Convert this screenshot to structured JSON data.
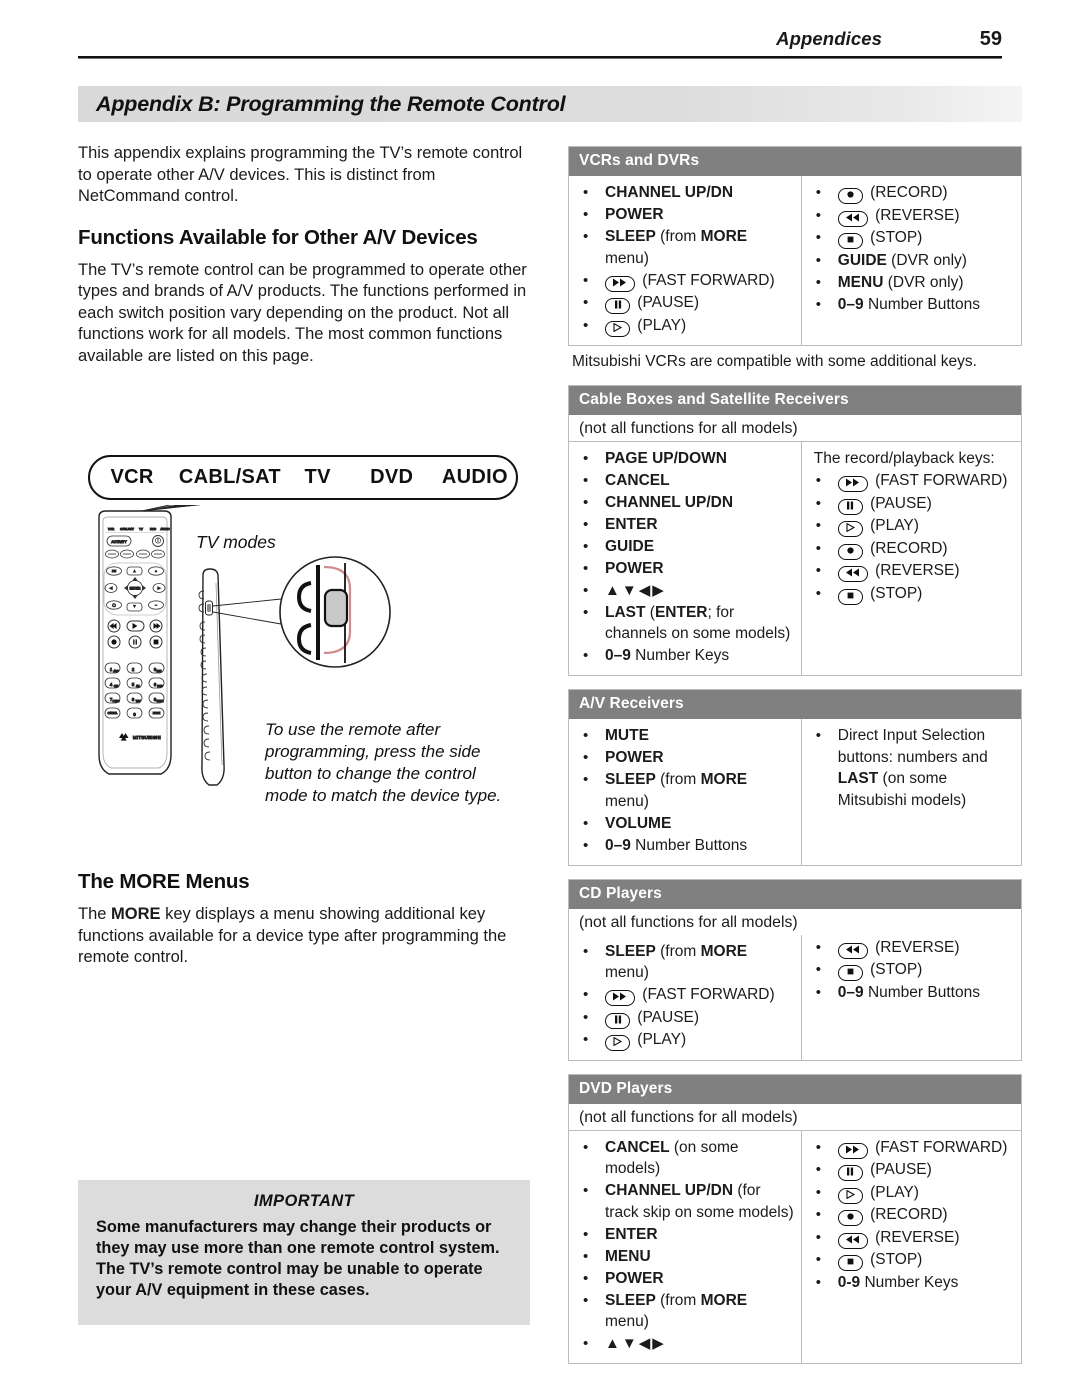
{
  "header": {
    "title": "Appendices",
    "page_number": "59"
  },
  "appendix_title": "Appendix B:  Programming the Remote Control",
  "left_column": {
    "intro_paragraph": "This appendix explains programming the TV’s remote control to operate other A/V devices.  This is distinct from NetCommand control.",
    "section1_heading": "Functions Available for Other A/V Devices",
    "section1_paragraph": "The TV’s remote control can be programmed to operate other types and brands of A/V products. The functions performed in each switch position vary depending on the product.  Not all functions work for all models.  The most common functions available are listed on this page.",
    "mode_switch_labels": [
      "VCR",
      "CABL/SAT",
      "TV",
      "DVD",
      "AUDIO"
    ],
    "tv_modes_label": "TV modes",
    "side_button_note": "To use the remote after programming, press the side button to change the control mode to match the device type.",
    "section2_heading": "The MORE Menus",
    "section2_paragraph_parts": [
      "The ",
      "MORE",
      " key displays a menu showing additional key functions available for a device type after programming the remote control."
    ],
    "important": {
      "title": "IMPORTANT",
      "body": "Some manufacturers may change their products or they may use more than one remote control system.  The TV’s remote control may be unable to operate your A/V equipment in these cases."
    }
  },
  "tables": {
    "vcrs_dvrs": {
      "heading": "VCRs and DVRs",
      "left_items": [
        {
          "bold": "CHANNEL UP/DN",
          "rest": ""
        },
        {
          "bold": "POWER",
          "rest": ""
        },
        {
          "bold": "SLEEP",
          "rest": " (from ",
          "bold2": "MORE",
          "rest2": " menu)"
        },
        {
          "icon": "fast-forward",
          "rest": " (FAST FORWARD)"
        },
        {
          "icon": "pause",
          "rest": " (PAUSE)"
        },
        {
          "icon": "play",
          "rest": " (PLAY)"
        }
      ],
      "right_items": [
        {
          "icon": "record",
          "rest": " (RECORD)"
        },
        {
          "icon": "reverse",
          "rest": " (REVERSE)"
        },
        {
          "icon": "stop",
          "rest": " (STOP)"
        },
        {
          "bold": "GUIDE",
          "rest": " (DVR only)"
        },
        {
          "bold": "MENU",
          "rest": " (DVR only)"
        },
        {
          "bold": "0–9",
          "rest": " Number Buttons"
        }
      ],
      "footnote": "Mitsubishi VCRs are compatible with some additional keys."
    },
    "cable_satellite": {
      "heading": "Cable Boxes and Satellite Receivers",
      "note": "(not all functions for all models)",
      "left_items": [
        {
          "bold": "PAGE UP/DOWN",
          "rest": ""
        },
        {
          "bold": "CANCEL",
          "rest": ""
        },
        {
          "bold": "CHANNEL UP/DN",
          "rest": ""
        },
        {
          "bold": "ENTER",
          "rest": ""
        },
        {
          "bold": "GUIDE",
          "rest": ""
        },
        {
          "bold": "POWER",
          "rest": ""
        },
        {
          "icon": "arrows",
          "rest": ""
        },
        {
          "bold": "LAST",
          "rest": " (",
          "bold2": "ENTER",
          "rest2": "; for channels on some models)"
        },
        {
          "bold": "0–9",
          "rest": " Number Keys"
        }
      ],
      "right_intro": "The record/playback keys:",
      "right_items": [
        {
          "icon": "fast-forward",
          "rest": " (FAST FORWARD)"
        },
        {
          "icon": "pause",
          "rest": " (PAUSE)"
        },
        {
          "icon": "play",
          "rest": " (PLAY)"
        },
        {
          "icon": "record",
          "rest": " (RECORD)"
        },
        {
          "icon": "reverse",
          "rest": " (REVERSE)"
        },
        {
          "icon": "stop",
          "rest": " (STOP)"
        }
      ]
    },
    "av_receivers": {
      "heading": "A/V Receivers",
      "left_items": [
        {
          "bold": "MUTE",
          "rest": ""
        },
        {
          "bold": "POWER",
          "rest": ""
        },
        {
          "bold": "SLEEP",
          "rest": " (from ",
          "bold2": "MORE",
          "rest2": " menu)"
        },
        {
          "bold": "VOLUME",
          "rest": ""
        },
        {
          "bold": "0–9",
          "rest": " Number Buttons"
        }
      ],
      "right_items": [
        {
          "rest": "Direct Input Selection buttons:  numbers and ",
          "bold2": "LAST",
          "rest2": " (on some Mitsubishi models)"
        }
      ]
    },
    "cd_players": {
      "heading": "CD Players",
      "note": "(not all functions for all models)",
      "left_items": [
        {
          "bold": "SLEEP",
          "rest": " (from ",
          "bold2": "MORE",
          "rest2": " menu)"
        },
        {
          "icon": "fast-forward",
          "rest": " (FAST FORWARD)"
        },
        {
          "icon": "pause",
          "rest": " (PAUSE)"
        },
        {
          "icon": "play",
          "rest": " (PLAY)"
        }
      ],
      "right_items": [
        {
          "icon": "reverse",
          "rest": " (REVERSE)"
        },
        {
          "icon": "stop",
          "rest": " (STOP)"
        },
        {
          "bold": "0–9",
          "rest": " Number Buttons"
        }
      ]
    },
    "dvd_players": {
      "heading": "DVD Players",
      "note": "(not all functions for all models)",
      "left_items": [
        {
          "bold": "CANCEL",
          "rest": " (on some models)"
        },
        {
          "bold": "CHANNEL UP/DN",
          "rest": " (for track skip on some models)"
        },
        {
          "bold": "ENTER",
          "rest": ""
        },
        {
          "bold": "MENU",
          "rest": ""
        },
        {
          "bold": "POWER",
          "rest": ""
        },
        {
          "bold": "SLEEP",
          "rest": " (from ",
          "bold2": "MORE",
          "rest2": " menu)"
        },
        {
          "icon": "arrows",
          "rest": ""
        }
      ],
      "right_items": [
        {
          "icon": "fast-forward",
          "rest": " (FAST FORWARD)"
        },
        {
          "icon": "pause",
          "rest": " (PAUSE)"
        },
        {
          "icon": "play",
          "rest": " (PLAY)"
        },
        {
          "icon": "record",
          "rest": " (RECORD)"
        },
        {
          "icon": "reverse",
          "rest": " (REVERSE)"
        },
        {
          "icon": "stop",
          "rest": " (STOP)"
        },
        {
          "bold": "0-9",
          "rest": " Number Keys"
        }
      ]
    }
  },
  "remote_illustration": {
    "brand": "MITSUBISHI",
    "mode_strip_labels": [
      "VCR",
      "CABL/SAT",
      "TV",
      "DVD",
      "AUDIO"
    ],
    "activity_button": "ACTIVITY",
    "enter_button": "ENTER",
    "more_button": "MORE",
    "number_keys": [
      "1",
      "2",
      "3",
      "4",
      "5",
      "6",
      "7",
      "8",
      "9",
      "0"
    ]
  },
  "colors": {
    "table_header_gray": "#808080",
    "table_border": "#b8bcc4",
    "important_box_gray": "#dcdcdc",
    "title_bar_gray": "#d9d9d9",
    "text": "#1b1b1b"
  }
}
